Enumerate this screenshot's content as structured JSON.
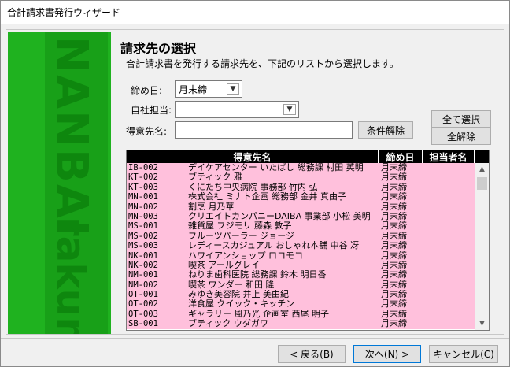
{
  "window": {
    "title": "合計請求書発行ウィザード"
  },
  "banner": {
    "text_top": "NANBAI",
    "text_bottom": "rakuna"
  },
  "page": {
    "heading": "請求先の選択",
    "subtext": "合計請求書を発行する請求先を、下記のリストから選択します。"
  },
  "form": {
    "closing_label": "締め日:",
    "closing_value": "月末締",
    "staff_label": "自社担当:",
    "staff_value": "",
    "customer_label": "得意先名:",
    "customer_value": "",
    "clear_button": "条件解除",
    "select_all_button": "全て選択",
    "deselect_all_button": "全解除"
  },
  "list": {
    "columns": [
      "得意先名",
      "締め日",
      "担当者名"
    ],
    "rows": [
      {
        "code": "IB-002",
        "name": "デイケアセンター いたばし 総務課 村田 英明",
        "closing": "月末締",
        "staff": ""
      },
      {
        "code": "KT-002",
        "name": "ブティック 雅",
        "closing": "月末締",
        "staff": ""
      },
      {
        "code": "KT-003",
        "name": "くにたち中央病院 事務部 竹内 弘",
        "closing": "月末締",
        "staff": ""
      },
      {
        "code": "MN-001",
        "name": "株式会社 ミナト企画 総務部 金井 真由子",
        "closing": "月末締",
        "staff": ""
      },
      {
        "code": "MN-002",
        "name": "割烹 月乃華",
        "closing": "月末締",
        "staff": ""
      },
      {
        "code": "MN-003",
        "name": "クリエイトカンパニーDAIBA 事業部 小松 美明",
        "closing": "月末締",
        "staff": ""
      },
      {
        "code": "MS-001",
        "name": "雑貨屋 フジモリ 藤森 敦子",
        "closing": "月末締",
        "staff": ""
      },
      {
        "code": "MS-002",
        "name": "フルーツパーラー ジョージ",
        "closing": "月末締",
        "staff": ""
      },
      {
        "code": "MS-003",
        "name": "レディースカジュアル おしゃれ本舗 中谷 冴",
        "closing": "月末締",
        "staff": ""
      },
      {
        "code": "NK-001",
        "name": "ハワイアンショップ ロコモコ",
        "closing": "月末締",
        "staff": ""
      },
      {
        "code": "NK-002",
        "name": "喫茶 アールグレイ",
        "closing": "月末締",
        "staff": ""
      },
      {
        "code": "NM-001",
        "name": "ねりま歯科医院 総務課 鈴木 明日香",
        "closing": "月末締",
        "staff": ""
      },
      {
        "code": "NM-002",
        "name": "喫茶 ワンダー 和田 隆",
        "closing": "月末締",
        "staff": ""
      },
      {
        "code": "OT-001",
        "name": "みゆき美容院 井上 美由紀",
        "closing": "月末締",
        "staff": ""
      },
      {
        "code": "OT-002",
        "name": "洋食屋 クイック・キッチン",
        "closing": "月末締",
        "staff": ""
      },
      {
        "code": "OT-003",
        "name": "ギャラリー 風乃光 企画室 西尾 明子",
        "closing": "月末締",
        "staff": ""
      },
      {
        "code": "SB-001",
        "name": "ブティック ウダガワ",
        "closing": "月末締",
        "staff": ""
      }
    ]
  },
  "footer": {
    "back_button": "< 戻る(B)",
    "next_button": "次へ(N) >",
    "cancel_button": "キャンセル(C)"
  }
}
